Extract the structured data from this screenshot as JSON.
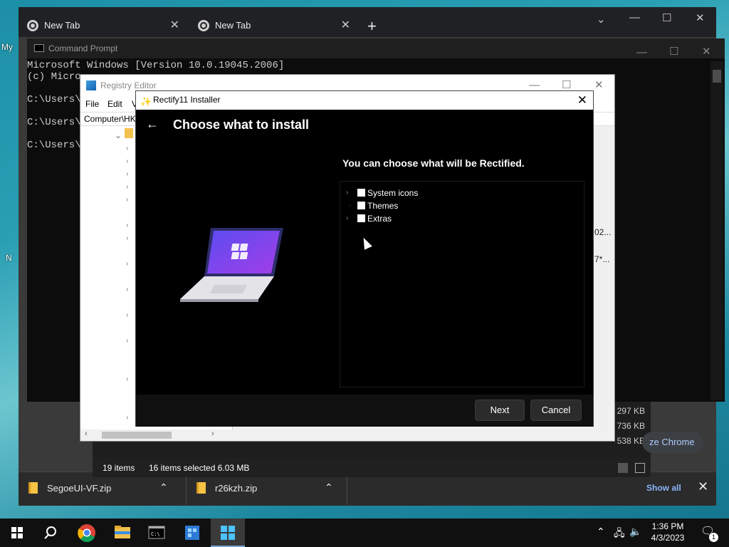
{
  "desktop": {
    "fragments": [
      "My",
      "N"
    ]
  },
  "chrome": {
    "tabs": [
      {
        "label": "New Tab"
      },
      {
        "label": "New Tab"
      }
    ],
    "new_tab_label": "+",
    "downloads": [
      {
        "name": "SegoeUI-VF.zip"
      },
      {
        "name": "r26kzh.zip"
      }
    ],
    "show_all_label": "Show all",
    "customize_pill": "ze Chrome"
  },
  "explorer": {
    "status_items": "19 items",
    "status_selected": "16 items selected  6.03 MB",
    "sizes": [
      "297 KB",
      "736 KB",
      "538 KB"
    ]
  },
  "cmd": {
    "title": "Command Prompt",
    "lines": [
      "Microsoft Windows [Version 10.0.19045.2006]",
      "(c) Micro",
      "",
      "C:\\Users\\",
      "",
      "C:\\Users\\",
      "",
      "C:\\Users\\"
    ]
  },
  "regedit": {
    "title": "Registry Editor",
    "menu": [
      "File",
      "Edit",
      "V"
    ],
    "address": "Computer\\HK",
    "truncated": [
      "02...",
      "7*..."
    ]
  },
  "installer": {
    "title": "Rectify11 Installer",
    "heading": "Choose what to install",
    "subtitle": "You can choose what will be Rectified.",
    "options": [
      {
        "label": "System icons",
        "expandable": true,
        "checked": false
      },
      {
        "label": "Themes",
        "expandable": false,
        "checked": false
      },
      {
        "label": "Extras",
        "expandable": true,
        "checked": false
      }
    ],
    "next_label": "Next",
    "cancel_label": "Cancel"
  },
  "taskbar": {
    "time": "1:36 PM",
    "date": "4/3/2023",
    "notification_count": "1"
  },
  "colors": {
    "installer_bg": "#000000",
    "accent_purple": "#7a3cf0",
    "link_blue": "#8ab4f8"
  }
}
